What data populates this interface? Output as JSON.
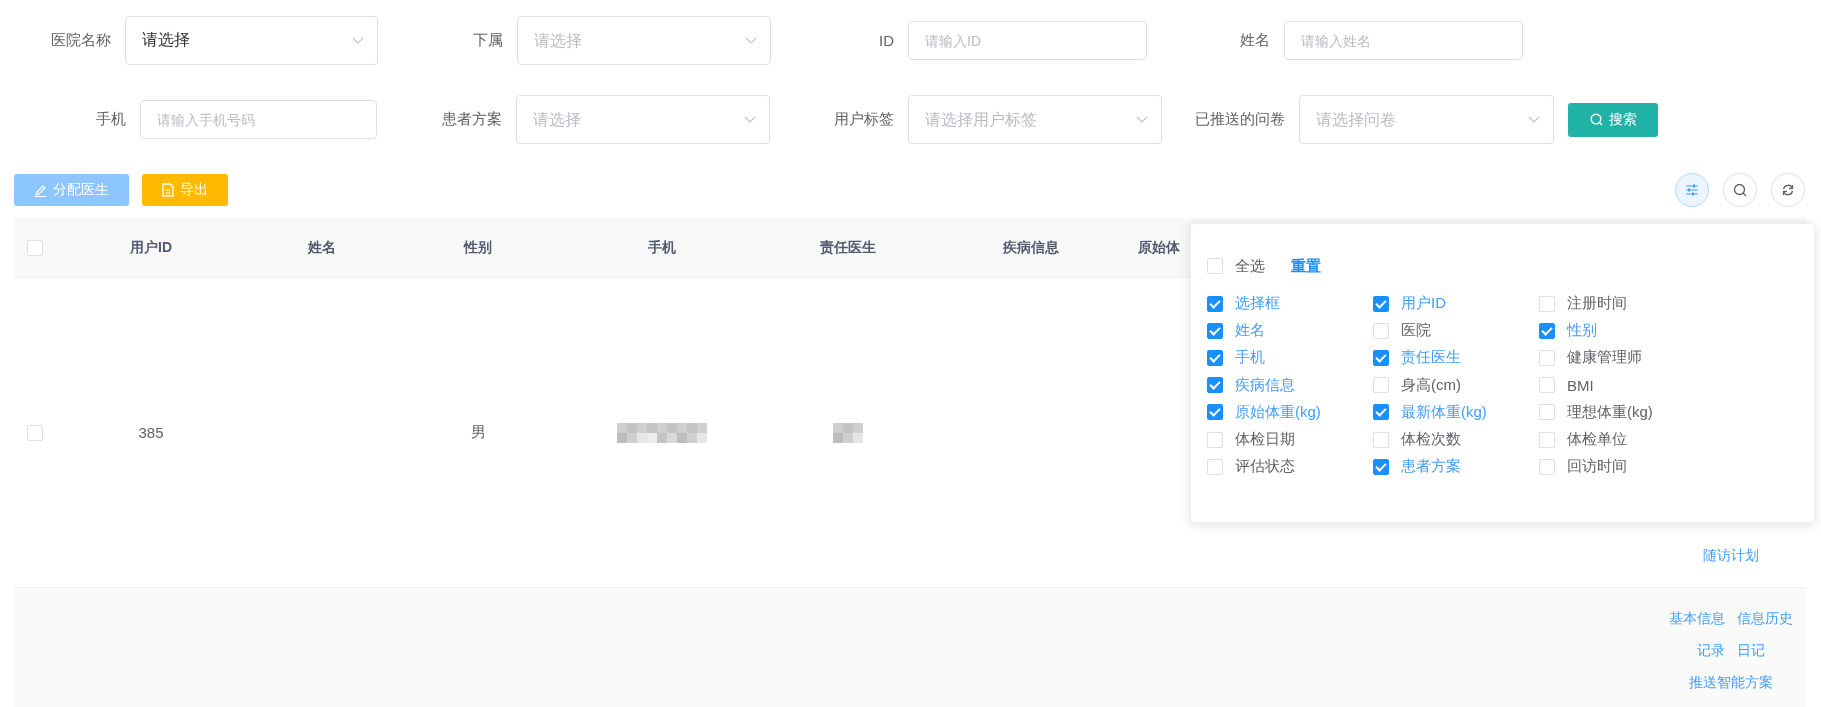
{
  "filters": {
    "rows": [
      [
        {
          "label": "医院名称",
          "kind": "select",
          "value": "请选择"
        },
        {
          "label": "下属",
          "kind": "select",
          "placeholder": "请选择"
        },
        {
          "label": "ID",
          "kind": "input",
          "placeholder": "请输入ID"
        },
        {
          "label": "姓名",
          "kind": "input",
          "placeholder": "请输入姓名"
        }
      ],
      [
        {
          "label": "手机",
          "kind": "input",
          "placeholder": "请输入手机号码"
        },
        {
          "label": "患者方案",
          "kind": "select",
          "placeholder": "请选择"
        },
        {
          "label": "用户标签",
          "kind": "select",
          "placeholder": "请选择用户标签"
        },
        {
          "label": "已推送的问卷",
          "kind": "select",
          "placeholder": "请选择问卷"
        }
      ]
    ],
    "search_button": "搜索"
  },
  "toolbar": {
    "buttons": [
      {
        "label": "分配医生",
        "kind": "assign",
        "disabled": true
      },
      {
        "label": "导出",
        "kind": "export",
        "disabled": false
      }
    ],
    "tool_buttons": [
      {
        "kind": "columns",
        "selected": true
      },
      {
        "kind": "search",
        "selected": false
      },
      {
        "kind": "refresh",
        "selected": false
      }
    ]
  },
  "table": {
    "header_checked": false,
    "columns": [
      "用户ID",
      "姓名",
      "性别",
      "手机",
      "责任医生",
      "疾病信息",
      "原始体"
    ],
    "rows": [
      {
        "checked": false,
        "cells": [
          {
            "kind": "text",
            "text": "385"
          },
          {
            "kind": "empty"
          },
          {
            "kind": "text",
            "text": "男"
          },
          {
            "kind": "redacted"
          },
          {
            "kind": "redacted"
          },
          {
            "kind": "empty"
          },
          {
            "kind": "empty"
          }
        ],
        "actions": [
          [
            "随访计划"
          ]
        ],
        "striped": false
      },
      {
        "cells": [],
        "actions": [
          [
            "基本信息",
            "信息历史"
          ],
          [
            "记录",
            "日记"
          ],
          [
            "推送智能方案"
          ]
        ],
        "striped": true
      }
    ]
  },
  "column_settings": {
    "select_all": {
      "label": "全选",
      "checked": false
    },
    "reset": "重置",
    "options": [
      {
        "label": "选择框",
        "checked": true
      },
      {
        "label": "用户ID",
        "checked": true
      },
      {
        "label": "注册时间",
        "checked": false
      },
      {
        "label": "姓名",
        "checked": true
      },
      {
        "label": "医院",
        "checked": false
      },
      {
        "label": "性别",
        "checked": true
      },
      {
        "label": "手机",
        "checked": true
      },
      {
        "label": "责任医生",
        "checked": true
      },
      {
        "label": "健康管理师",
        "checked": false
      },
      {
        "label": "疾病信息",
        "checked": true
      },
      {
        "label": "身高(cm)",
        "checked": false
      },
      {
        "label": "BMI",
        "checked": false
      },
      {
        "label": "原始体重(kg)",
        "checked": true
      },
      {
        "label": "最新体重(kg)",
        "checked": true
      },
      {
        "label": "理想体重(kg)",
        "checked": false
      },
      {
        "label": "体检日期",
        "checked": false
      },
      {
        "label": "体检次数",
        "checked": false
      },
      {
        "label": "体检单位",
        "checked": false
      },
      {
        "label": "评估状态",
        "checked": false
      },
      {
        "label": "患者方案",
        "checked": true
      },
      {
        "label": "回访时间",
        "checked": false
      }
    ]
  }
}
